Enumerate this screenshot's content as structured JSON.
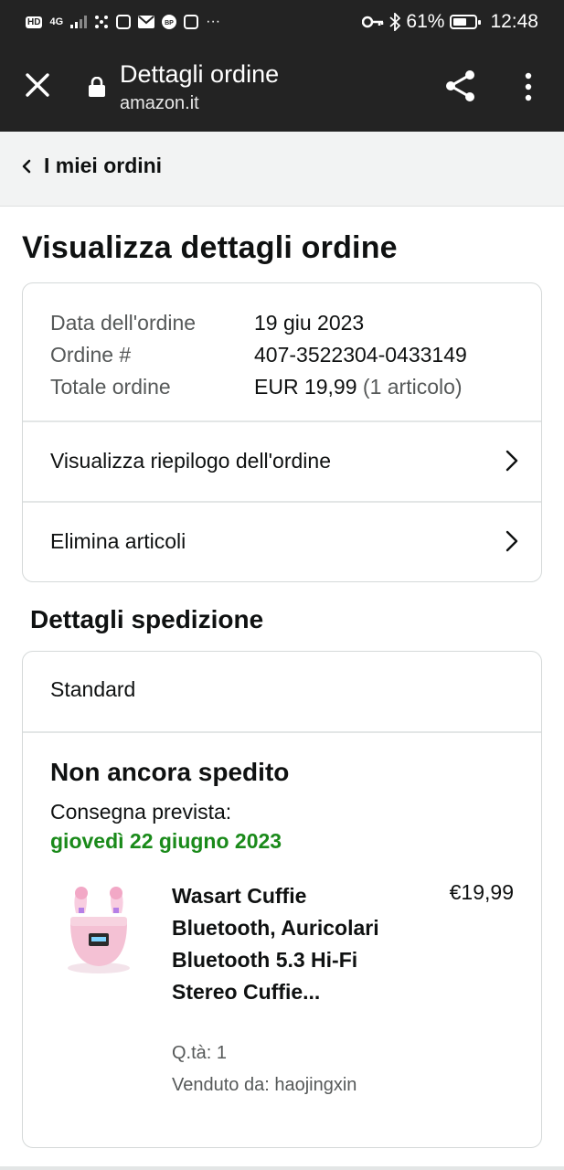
{
  "status_bar": {
    "network": "4G",
    "battery": "61%",
    "time": "12:48"
  },
  "browser": {
    "title": "Dettagli ordine",
    "url": "amazon.it"
  },
  "back_link": "I miei ordini",
  "heading": "Visualizza dettagli ordine",
  "order_info": {
    "date_label": "Data dell'ordine",
    "date_value": "19 giu 2023",
    "number_label": "Ordine #",
    "number_value": "407-3522304-0433149",
    "total_label": "Totale ordine",
    "total_value": "EUR 19,99",
    "total_items": "(1 articolo)"
  },
  "links": {
    "summary": "Visualizza riepilogo dell'ordine",
    "remove": "Elimina articoli"
  },
  "shipping": {
    "heading": "Dettagli spedizione",
    "method": "Standard",
    "status": "Non ancora spedito",
    "expected_label": "Consegna prevista:",
    "expected_date": "giovedì 22 giugno 2023",
    "expected_color": "#1a8a1a"
  },
  "product": {
    "title": "Wasart Cuffie Bluetooth, Auricolari Bluetooth 5.3 Hi-Fi Stereo Cuffie...",
    "price": "€19,99",
    "qty": "Q.tà: 1",
    "seller": "Venduto da: haojingxin",
    "image_icon": "pink-earbuds-case-icon"
  }
}
